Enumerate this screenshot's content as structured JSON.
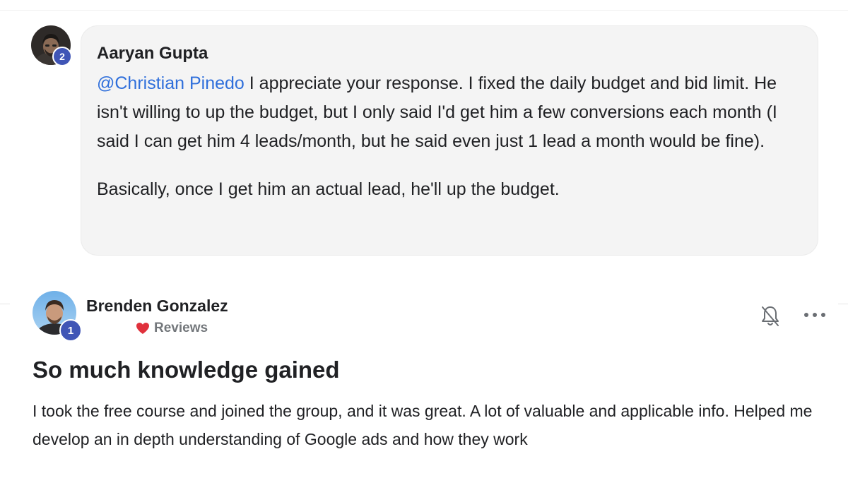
{
  "comment": {
    "author": "Aaryan Gupta",
    "level": "2",
    "mention": "@Christian Pinedo",
    "paragraph1": " I appreciate your response. I fixed the daily budget and bid limit. He isn't willing to up the budget, but I only said I'd get him a few conversions each month (I said I can get him 4 leads/month, but he said even just 1 lead a month would be fine).",
    "paragraph2": "Basically, once I get him an actual lead, he'll up the budget."
  },
  "post": {
    "author": "Brenden Gonzalez",
    "level": "1",
    "category": "Reviews",
    "title": "So much knowledge gained",
    "body": "I took the free course and joined the group, and it was great. A lot of valuable and applicable info. Helped me develop an in depth understanding of Google ads and how they work"
  },
  "icons": {
    "category": "red-heart-icon",
    "notifications": "bell-off-icon",
    "menu": "more-horizontal-icon"
  },
  "colors": {
    "mention": "#2f6fdb",
    "level_badge": "#4055b6",
    "bubble_bg": "#f4f4f4",
    "heart": "#e0313c"
  }
}
